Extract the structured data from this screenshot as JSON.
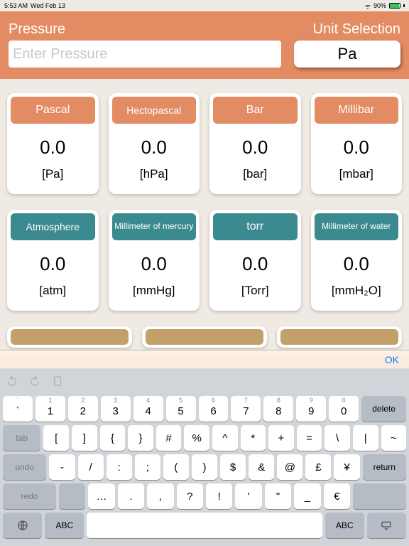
{
  "status": {
    "time": "5:53 AM",
    "date": "Wed Feb 13",
    "battery": "90%"
  },
  "header": {
    "pressure_label": "Pressure",
    "unit_label": "Unit Selection",
    "placeholder": "Enter Pressure",
    "value": "",
    "selected_unit": "Pa"
  },
  "cards": [
    {
      "title": "Pascal",
      "value": "0.0",
      "unit": "[Pa]",
      "color": "orange",
      "size": "norm"
    },
    {
      "title": "Hectopascal",
      "value": "0.0",
      "unit": "[hPa]",
      "color": "orange",
      "size": "med"
    },
    {
      "title": "Bar",
      "value": "0.0",
      "unit": "[bar]",
      "color": "orange",
      "size": "norm"
    },
    {
      "title": "Millibar",
      "value": "0.0",
      "unit": "[mbar]",
      "color": "orange",
      "size": "norm"
    },
    {
      "title": "Atmosphere",
      "value": "0.0",
      "unit": "[atm]",
      "color": "teal",
      "size": "med"
    },
    {
      "title": "Millimeter of mercury",
      "value": "0.0",
      "unit": "[mmHg]",
      "color": "teal",
      "size": "small"
    },
    {
      "title": "torr",
      "value": "0.0",
      "unit": "[Torr]",
      "color": "teal",
      "size": "norm"
    },
    {
      "title": "Millimeter of water",
      "value": "0.0",
      "unit": "[mmH₂O]",
      "color": "teal",
      "size": "small"
    }
  ],
  "row3_color": "tan",
  "keyboard": {
    "ok_label": "OK",
    "row1_upper": [
      "`",
      "1",
      "2",
      "3",
      "4",
      "5",
      "6",
      "7",
      "8",
      "9",
      "0",
      "delete"
    ],
    "row1_main": [
      "`",
      "1",
      "2",
      "3",
      "4",
      "5",
      "6",
      "7",
      "8",
      "9",
      "0"
    ],
    "row2_left": "tab",
    "row2": [
      "[",
      "]",
      "{",
      "}",
      "#",
      "%",
      "^",
      "*",
      "+",
      "=",
      "\\",
      "|",
      "~"
    ],
    "row3_left": "undo",
    "row3": [
      "-",
      "/",
      ":",
      ";",
      "(",
      ")",
      "$",
      "&",
      "@",
      "£",
      "¥",
      "return"
    ],
    "row4_left": "redo",
    "row4": [
      "…",
      ".",
      ",",
      "?",
      "!",
      "'",
      "\"",
      "_",
      "€"
    ],
    "row5": {
      "abc": "ABC"
    }
  }
}
